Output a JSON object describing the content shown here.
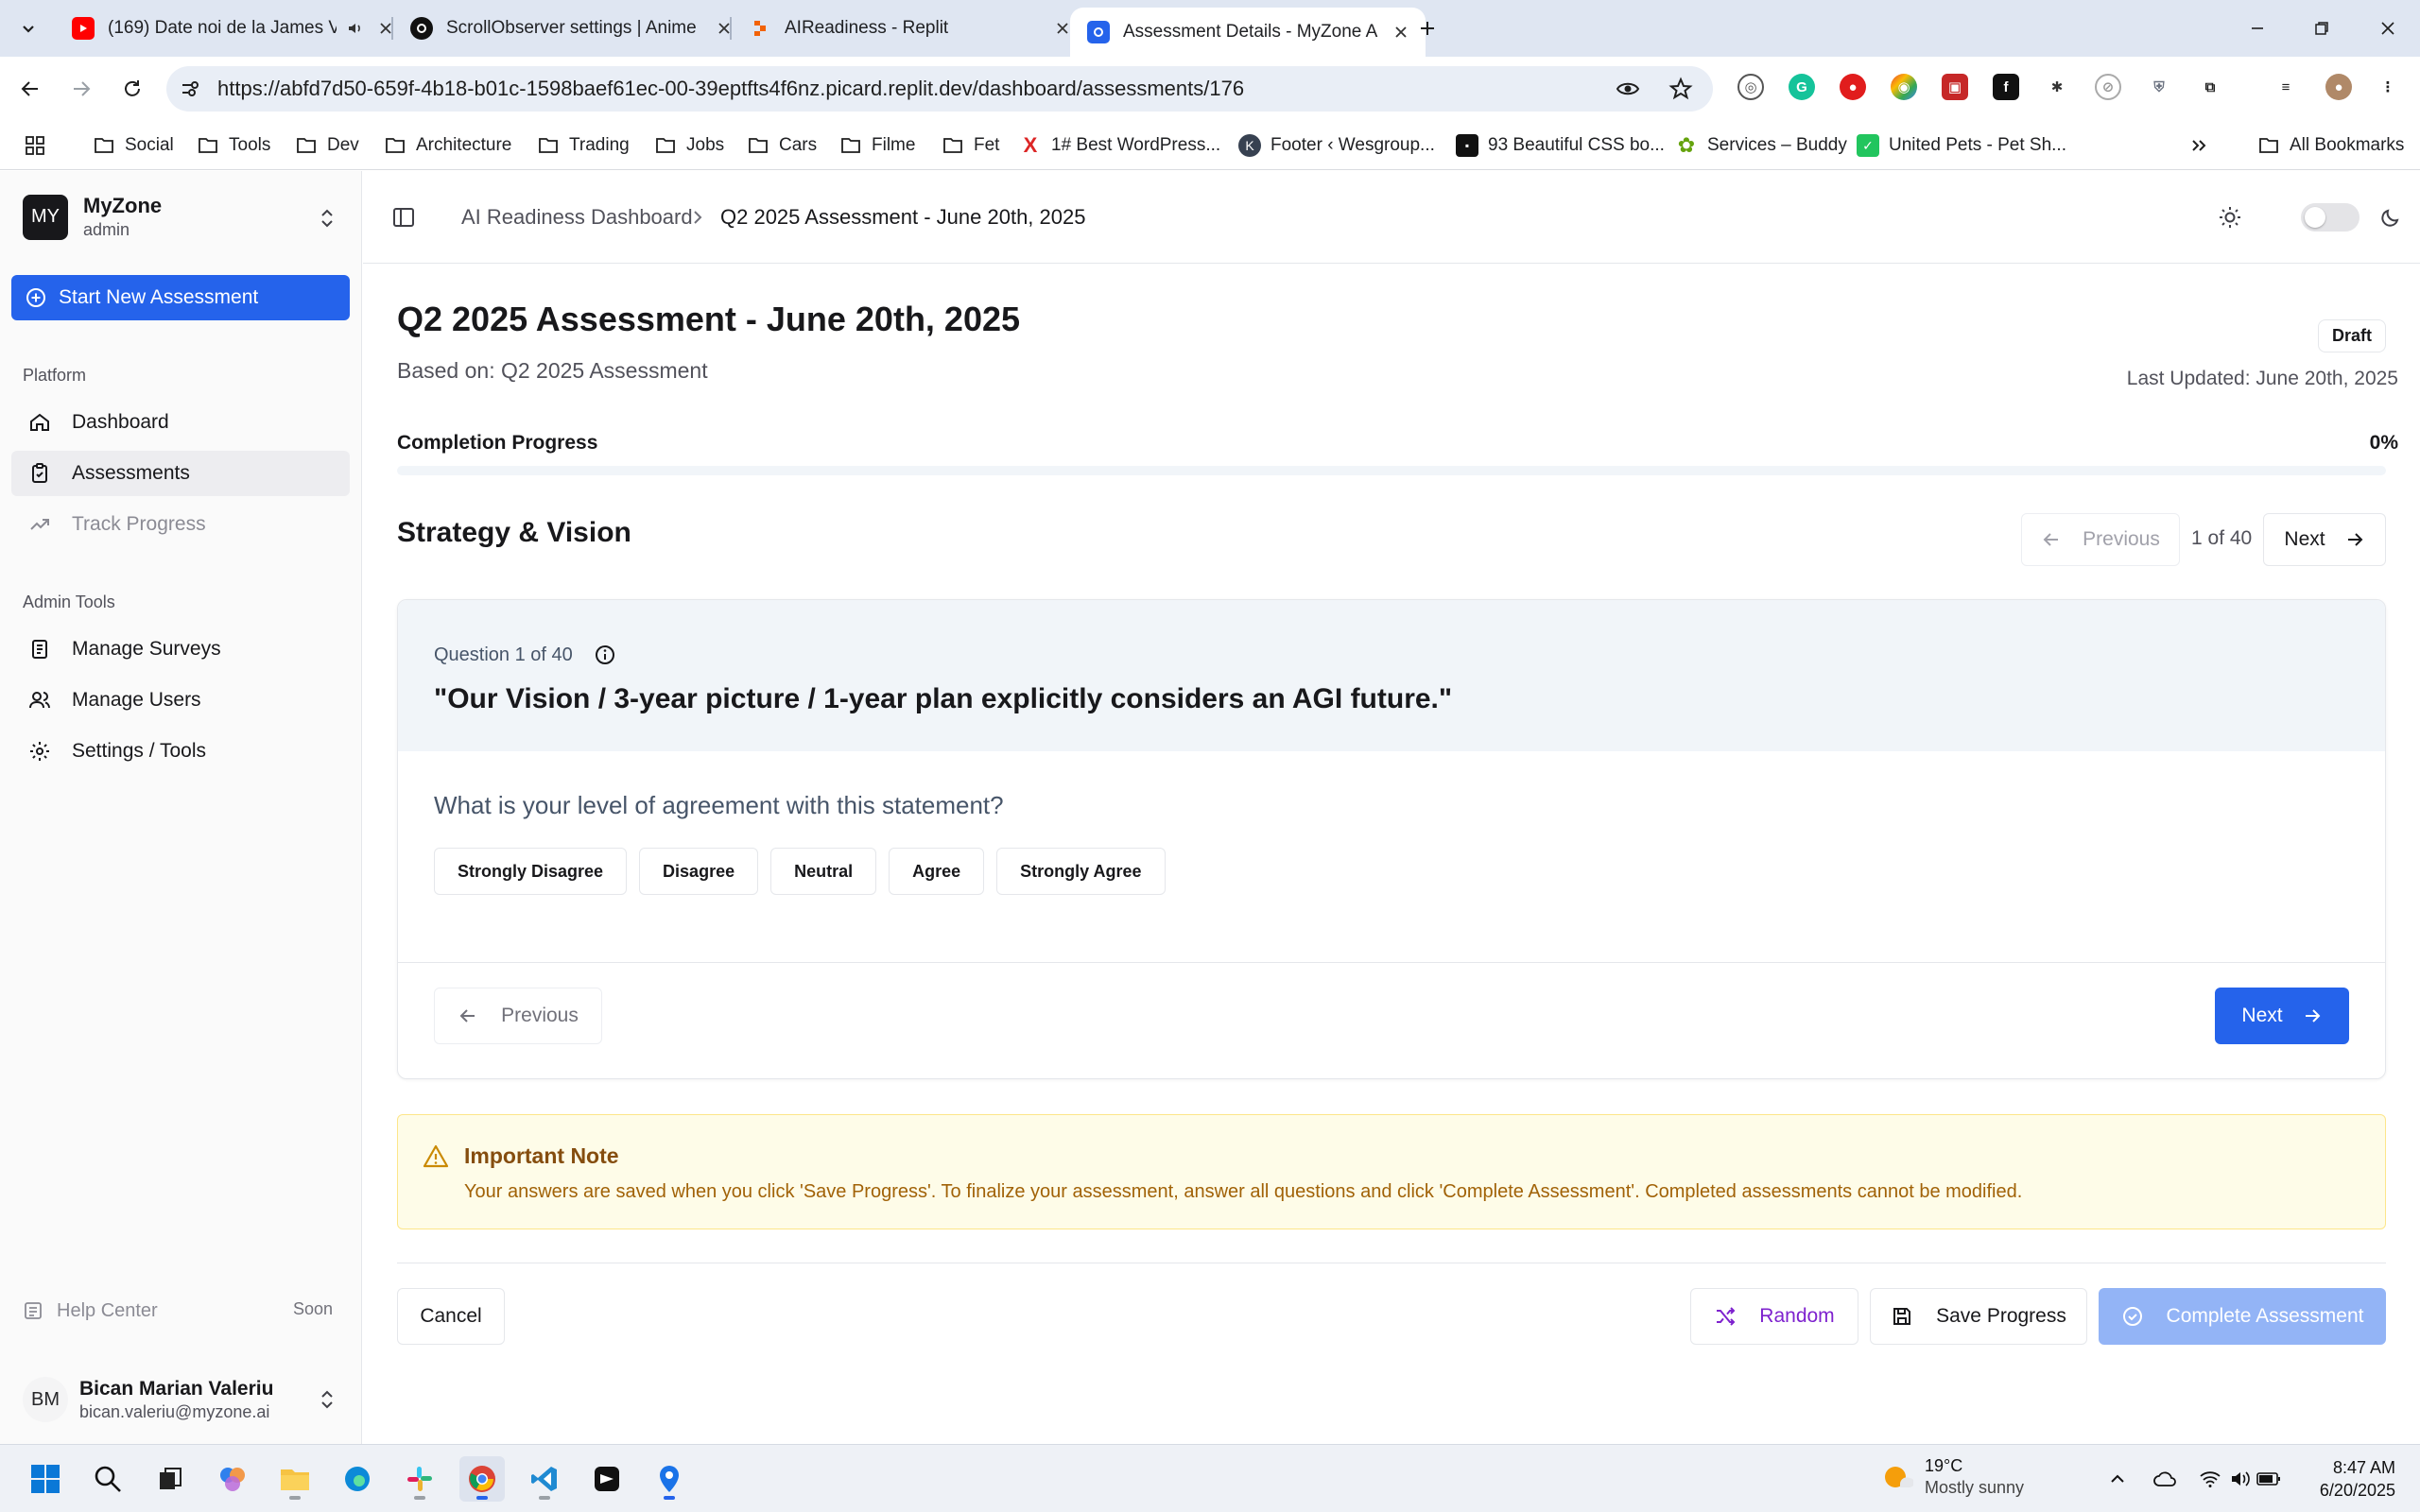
{
  "browser": {
    "tabs": [
      {
        "title": "(169) Date noi de la James V"
      },
      {
        "title": "ScrollObserver settings | Anime"
      },
      {
        "title": "AIReadiness - Replit"
      },
      {
        "title": "Assessment Details - MyZone A"
      }
    ],
    "url": "https://abfd7d50-659f-4b18-b01c-1598baef61ec-00-39eptfts4f6nz.picard.replit.dev/dashboard/assessments/176",
    "bookmarks": [
      {
        "label": "Social",
        "icon": "folder-icon"
      },
      {
        "label": "Tools",
        "icon": "folder-icon"
      },
      {
        "label": "Dev",
        "icon": "folder-icon"
      },
      {
        "label": "Architecture",
        "icon": "folder-icon"
      },
      {
        "label": "Trading",
        "icon": "folder-icon"
      },
      {
        "label": "Jobs",
        "icon": "folder-icon"
      },
      {
        "label": "Cars",
        "icon": "folder-icon"
      },
      {
        "label": "Filme",
        "icon": "folder-icon"
      },
      {
        "label": "Fet",
        "icon": "folder-icon"
      },
      {
        "label": "1# Best WordPress...",
        "icon": "x-logo-icon"
      },
      {
        "label": "Footer ‹ Wesgroup...",
        "icon": "k-logo-icon"
      },
      {
        "label": "93 Beautiful CSS bo...",
        "icon": "css-logo-icon"
      },
      {
        "label": "Services – Buddy",
        "icon": "paw-icon"
      },
      {
        "label": "United Pets - Pet Sh...",
        "icon": "pet-logo-icon"
      }
    ],
    "all_bookmarks": "All Bookmarks"
  },
  "sidebar": {
    "org_initials": "MY",
    "org_name": "MyZone",
    "org_role": "admin",
    "start_button": "Start New Assessment",
    "platform_label": "Platform",
    "platform_items": [
      {
        "label": "Dashboard",
        "icon": "home-icon"
      },
      {
        "label": "Assessments",
        "icon": "clipboard-check-icon"
      },
      {
        "label": "Track Progress",
        "icon": "trending-up-icon"
      }
    ],
    "admin_label": "Admin Tools",
    "admin_items": [
      {
        "label": "Manage Surveys",
        "icon": "document-list-icon"
      },
      {
        "label": "Manage Users",
        "icon": "users-icon"
      },
      {
        "label": "Settings / Tools",
        "icon": "gear-icon"
      }
    ],
    "help_label": "Help Center",
    "help_badge": "Soon",
    "user_initials": "BM",
    "user_name": "Bican Marian Valeriu",
    "user_email": "bican.valeriu@myzone.ai"
  },
  "header": {
    "breadcrumb_root": "AI Readiness Dashboard",
    "breadcrumb_current": "Q2 2025 Assessment - June 20th, 2025"
  },
  "assessment": {
    "title": "Q2 2025 Assessment - June 20th, 2025",
    "based_on": "Based on: Q2 2025 Assessment",
    "status": "Draft",
    "last_updated": "Last Updated: June 20th, 2025",
    "progress_label": "Completion Progress",
    "progress_text": "0%",
    "progress_fraction": 0,
    "section_title": "Strategy & Vision",
    "pager_previous": "Previous",
    "pager_count": "1 of 40",
    "pager_next": "Next"
  },
  "question": {
    "number_label": "Question 1 of 40",
    "text": "\"Our Vision / 3-year picture / 1-year plan explicitly considers an AGI future.\"",
    "prompt": "What is your level of agreement with this statement?",
    "options": [
      "Strongly Disagree",
      "Disagree",
      "Neutral",
      "Agree",
      "Strongly Agree"
    ],
    "previous": "Previous",
    "next": "Next"
  },
  "note": {
    "title": "Important Note",
    "body": "Your answers are saved when you click 'Save Progress'. To finalize your assessment, answer all questions and click 'Complete Assessment'. Completed assessments cannot be modified."
  },
  "actions": {
    "cancel": "Cancel",
    "random": "Random",
    "save": "Save Progress",
    "complete": "Complete Assessment"
  },
  "taskbar": {
    "temperature": "19°C",
    "condition": "Mostly sunny",
    "time": "8:47 AM",
    "date": "6/20/2025"
  },
  "colors": {
    "primary": "#2563eb",
    "primary_disabled": "#93b4f6",
    "note_bg": "#fefce8",
    "note_title": "#854d0e",
    "random_text": "#7e22ce"
  }
}
